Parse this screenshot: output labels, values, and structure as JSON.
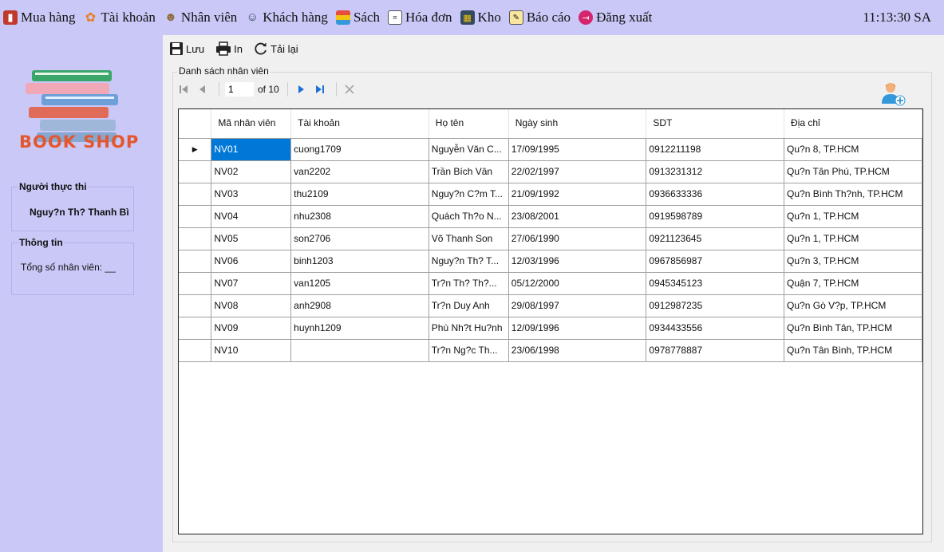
{
  "menu": {
    "items": [
      {
        "label": "Mua hàng",
        "icon": "shopping-icon"
      },
      {
        "label": "Tài khoản",
        "icon": "account-icon"
      },
      {
        "label": "Nhân viên",
        "icon": "staff-icon"
      },
      {
        "label": "Khách hàng",
        "icon": "customers-icon"
      },
      {
        "label": "Sách",
        "icon": "books-icon"
      },
      {
        "label": "Hóa đơn",
        "icon": "invoice-icon"
      },
      {
        "label": "Kho",
        "icon": "warehouse-icon"
      },
      {
        "label": "Báo cáo",
        "icon": "report-icon"
      },
      {
        "label": "Đăng xuất",
        "icon": "logout-icon"
      }
    ],
    "clock": "11:13:30 SA"
  },
  "sidebar": {
    "logo_text": "BOOK SHOP",
    "executor_title": "Người thực thi",
    "executor_name": "Nguy?n Th? Thanh Bì",
    "info_title": "Thông tin",
    "staff_count_label": "Tổng số nhân viên: __"
  },
  "toolbar": {
    "save_label": "Lưu",
    "print_label": "In",
    "reload_label": "Tải lại"
  },
  "list": {
    "title": "Danh sách nhân viên",
    "current_page": "1",
    "of_text": "of 10"
  },
  "grid": {
    "columns": [
      "Mã nhân viên",
      "Tài khoản",
      "Họ tên",
      "Ngày sinh",
      "SDT",
      "Địa chỉ"
    ],
    "rows": [
      [
        "NV01",
        "cuong1709",
        "Nguyễn Văn C...",
        "17/09/1995",
        "0912211198",
        "Qu?n 8, TP.HCM"
      ],
      [
        "NV02",
        "van2202",
        "Trần Bích Vân",
        "22/02/1997",
        "0913231312",
        "Qu?n Tân Phú, TP.HCM"
      ],
      [
        "NV03",
        "thu2109",
        "Nguy?n C?m T...",
        "21/09/1992",
        "0936633336",
        "Qu?n Bình Th?nh, TP.HCM"
      ],
      [
        "NV04",
        "nhu2308",
        "Quách Th?o N...",
        "23/08/2001",
        "0919598789",
        "Qu?n 1, TP.HCM"
      ],
      [
        "NV05",
        "son2706",
        "Võ Thanh Son",
        "27/06/1990",
        "0921123645",
        "Qu?n 1, TP.HCM"
      ],
      [
        "NV06",
        "binh1203",
        "Nguy?n Th? T...",
        "12/03/1996",
        "0967856987",
        "Qu?n 3, TP.HCM"
      ],
      [
        "NV07",
        "van1205",
        "Tr?n Th? Th?...",
        "05/12/2000",
        "0945345123",
        "Quận 7, TP.HCM"
      ],
      [
        "NV08",
        "anh2908",
        "Tr?n Duy Anh",
        "29/08/1997",
        "0912987235",
        "Qu?n Gò V?p, TP.HCM"
      ],
      [
        "NV09",
        "huynh1209",
        "Phù Nh?t Hu?nh",
        "12/09/1996",
        "0934433556",
        "Qu?n Bình Tân, TP.HCM"
      ],
      [
        "NV10",
        "",
        "Tr?n Ng?c Th...",
        "23/06/1998",
        "0978778887",
        "Qu?n Tân Bình, TP.HCM"
      ]
    ]
  }
}
